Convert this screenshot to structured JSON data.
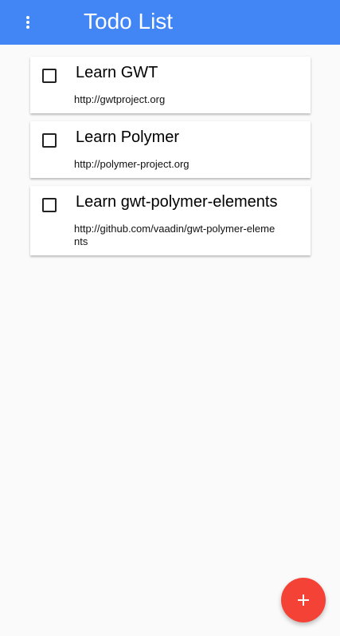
{
  "toolbar": {
    "title": "Todo List",
    "menu_icon": "more-vert-icon"
  },
  "todos": [
    {
      "title": "Learn GWT",
      "link": "http://gwtproject.org",
      "checked": false
    },
    {
      "title": "Learn Polymer",
      "link": "http://polymer-project.org",
      "checked": false
    },
    {
      "title": "Learn gwt-polymer-elements",
      "link": "http://github.com/vaadin/gwt-polymer-elements",
      "checked": false
    }
  ],
  "fab": {
    "icon": "plus-icon"
  },
  "colors": {
    "toolbar": "#4285f4",
    "fab": "#f44336",
    "background": "#fafafa"
  }
}
